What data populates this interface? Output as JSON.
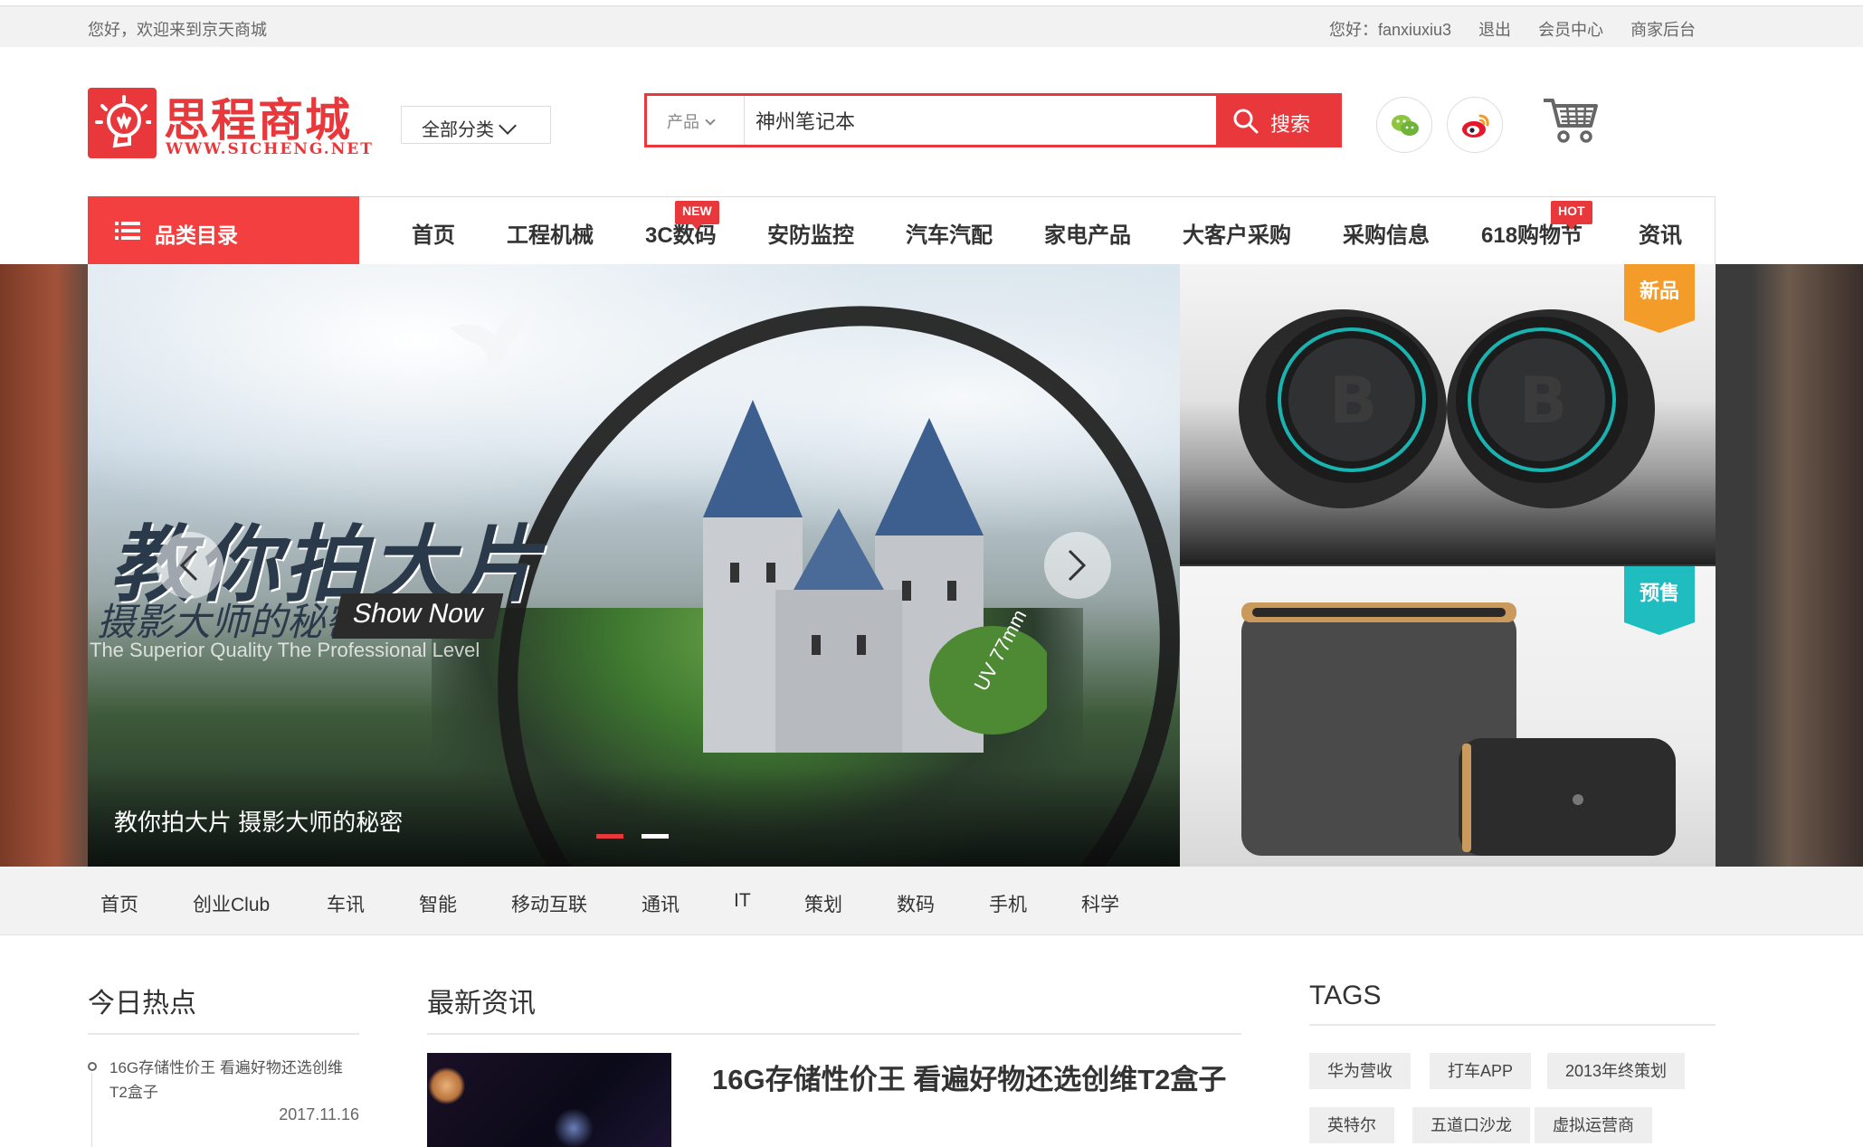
{
  "topbar": {
    "welcome": "您好，欢迎来到京天商城",
    "greeting": "您好：fanxiuxiu3",
    "logout": "退出",
    "member_center": "会员中心",
    "merchant_backend": "商家后台"
  },
  "logo": {
    "name": "思程商城",
    "url": "WWW.SICHENG.NET"
  },
  "header": {
    "all_categories": "全部分类",
    "search_type": "产品",
    "search_value": "神州笔记本",
    "search_button": "搜索"
  },
  "nav": {
    "category_menu": "品类目录",
    "items": [
      {
        "label": "首页"
      },
      {
        "label": "工程机械"
      },
      {
        "label": "3C数码",
        "tag": "NEW"
      },
      {
        "label": "安防监控"
      },
      {
        "label": "汽车汽配"
      },
      {
        "label": "家电产品"
      },
      {
        "label": "大客户采购"
      },
      {
        "label": "采购信息"
      },
      {
        "label": "618购物节",
        "tag": "HOT"
      },
      {
        "label": "资讯"
      }
    ]
  },
  "banner": {
    "headline": "教你拍大片",
    "sub": "摄影大师的秘密",
    "show_now": "Show Now",
    "tagline": "The Superior Quality The Professional Level",
    "caption": "教你拍大片 摄影大师的秘密",
    "lens_text": "UV 77mm",
    "side_top_ribbon": "新品",
    "side_bottom_ribbon": "预售"
  },
  "subnav": {
    "items": [
      "首页",
      "创业Club",
      "车讯",
      "智能",
      "移动互联",
      "通讯",
      "IT",
      "策划",
      "数码",
      "手机",
      "科学"
    ]
  },
  "hot": {
    "title": "今日热点",
    "items": [
      {
        "text": "16G存储性价王 看遍好物还选创维T2盒子",
        "date": "2017.11.16"
      }
    ]
  },
  "news": {
    "title": "最新资讯",
    "items": [
      {
        "title": "16G存储性价王 看遍好物还选创维T2盒子"
      }
    ]
  },
  "tags": {
    "title": "TAGS",
    "items": [
      "华为营收",
      "打车APP",
      "2013年终策划",
      "英特尔",
      "五道口沙龙",
      "虚拟运营商"
    ]
  },
  "colors": {
    "brand_red": "#e8383b",
    "nav_red": "#f33f3f",
    "orange_ribbon": "#f39c2a",
    "teal_ribbon": "#1fbcc0"
  }
}
